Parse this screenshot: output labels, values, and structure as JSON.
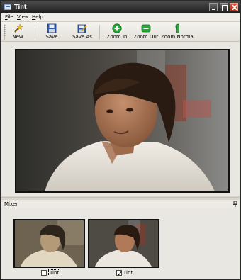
{
  "window": {
    "title": "Tint"
  },
  "menu": [
    {
      "mnemonic": "F",
      "rest": "ile"
    },
    {
      "mnemonic": "V",
      "rest": "iew"
    },
    {
      "mnemonic": "H",
      "rest": "elp"
    }
  ],
  "toolbar": {
    "new_label": "New",
    "save_label": "Save",
    "save_as_label": "Save As",
    "zoom_in_label": "Zoom In",
    "zoom_out_label": "Zoom Out",
    "zoom_normal_label": "Zoom Normal"
  },
  "mixer": {
    "title": "Mixer",
    "items": [
      {
        "label": "Tint",
        "checked": false
      },
      {
        "label": "Tint",
        "checked": true
      }
    ]
  },
  "colors": {
    "titlebar": "#1e1e1e",
    "close_button": "#c63a1c",
    "window_bg": "#e8e7e1",
    "zoom_icon_green": "#2aa63a",
    "save_icon_blue": "#2f5fa8"
  },
  "icons": {
    "new": "magic-wand-icon",
    "save": "floppy-disk-icon",
    "save_as": "floppy-pen-icon",
    "zoom_in": "plus-circle-icon",
    "zoom_out": "minus-circle-icon",
    "zoom_normal": "one-icon"
  }
}
